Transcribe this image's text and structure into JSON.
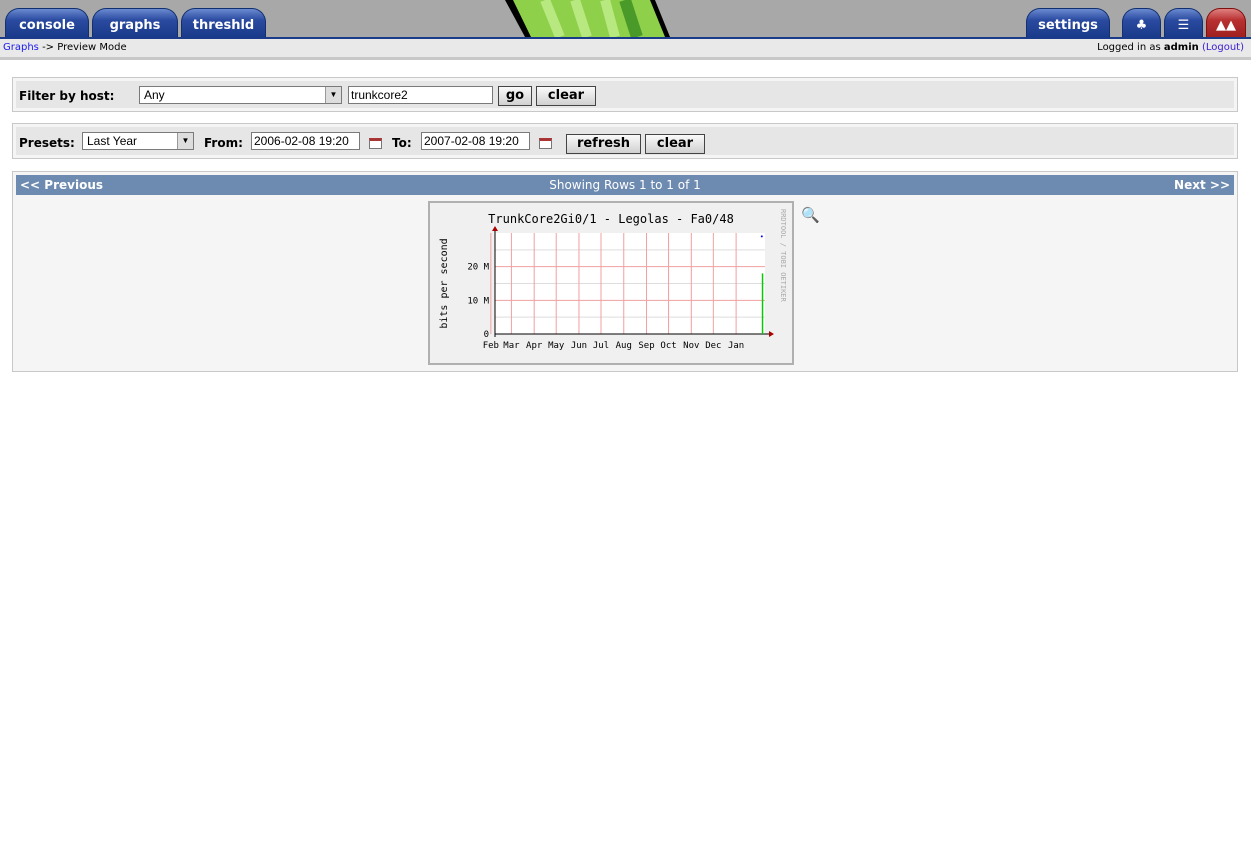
{
  "header": {
    "tabs": [
      {
        "label": "console"
      },
      {
        "label": "graphs"
      },
      {
        "label": "threshld"
      }
    ],
    "settings_label": "settings",
    "icons": [
      "tree-icon",
      "list-icon",
      "preview-icon"
    ]
  },
  "breadcrumb": {
    "link": "Graphs",
    "rest": "-> Preview Mode"
  },
  "login": {
    "prefix": "Logged in as",
    "user": "admin",
    "logout": "(Logout)"
  },
  "filter": {
    "label": "Filter by host:",
    "host_value": "Any",
    "search_value": "trunkcore2",
    "go": "go",
    "clear": "clear"
  },
  "timespan": {
    "presets_label": "Presets:",
    "preset_value": "Last Year",
    "from_label": "From:",
    "from_value": "2006-02-08 19:20",
    "to_label": "To:",
    "to_value": "2007-02-08 19:20",
    "refresh": "refresh",
    "clear": "clear"
  },
  "pager": {
    "prev": "<< Previous",
    "status": "Showing Rows 1 to 1 of 1",
    "next": "Next >>"
  },
  "chart_data": {
    "type": "line",
    "title": "TrunkCore2Gi0/1 - Legolas - Fa0/48",
    "ylabel": "bits per second",
    "watermark": "RRDTOOL / TOBI OETIKER",
    "x_tick_labels": [
      "Feb",
      "Mar",
      "Apr",
      "May",
      "Jun",
      "Jul",
      "Aug",
      "Sep",
      "Oct",
      "Nov",
      "Dec",
      "Jan"
    ],
    "y_tick_labels": [
      "0",
      "10 M",
      "20 M"
    ],
    "y_ticks": [
      0,
      10000000,
      20000000
    ],
    "ylim": [
      0,
      30000000
    ],
    "grid": true,
    "series": [
      {
        "color": "#00cc00",
        "points": [
          [
            "2007-02-06",
            0
          ],
          [
            "2007-02-06",
            18000000
          ]
        ]
      },
      {
        "color": "#0000ff",
        "points": [
          [
            "2007-02-05",
            29000000
          ]
        ]
      }
    ]
  }
}
